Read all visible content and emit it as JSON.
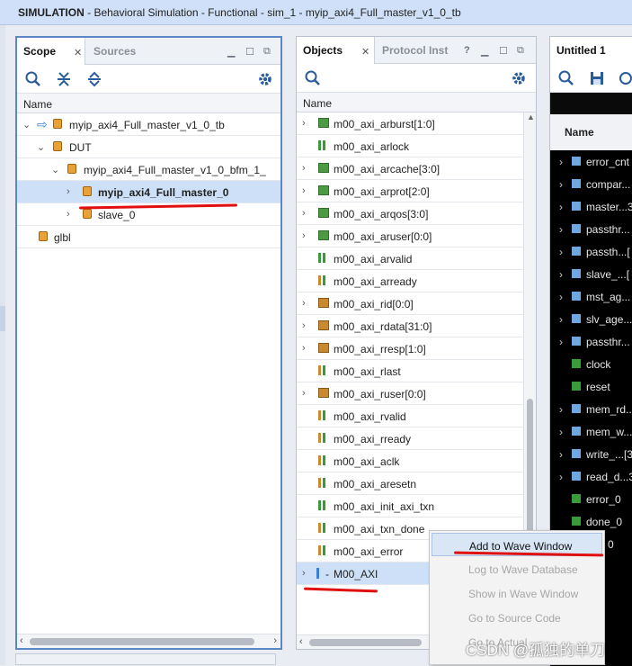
{
  "title": {
    "bold": "SIMULATION",
    "rest": " - Behavioral Simulation - Functional - sim_1 - myip_axi4_Full_master_v1_0_tb"
  },
  "scope": {
    "tabs": [
      "Scope",
      "Sources"
    ],
    "column": "Name",
    "rows": [
      "myip_axi4_Full_master_v1_0_tb",
      "DUT",
      "myip_axi4_Full_master_v1_0_bfm_1_",
      "myip_axi4_Full_master_0",
      "slave_0",
      "glbl"
    ]
  },
  "objects": {
    "tabs": [
      "Objects",
      "Protocol Inst"
    ],
    "help": "?",
    "column": "Name",
    "rows": [
      "m00_axi_arburst[1:0]",
      "m00_axi_arlock",
      "m00_axi_arcache[3:0]",
      "m00_axi_arprot[2:0]",
      "m00_axi_arqos[3:0]",
      "m00_axi_aruser[0:0]",
      "m00_axi_arvalid",
      "m00_axi_arready",
      "m00_axi_rid[0:0]",
      "m00_axi_rdata[31:0]",
      "m00_axi_rresp[1:0]",
      "m00_axi_rlast",
      "m00_axi_ruser[0:0]",
      "m00_axi_rvalid",
      "m00_axi_rready",
      "m00_axi_aclk",
      "m00_axi_aresetn",
      "m00_axi_init_axi_txn",
      "m00_axi_txn_done",
      "m00_axi_error",
      "M00_AXI"
    ]
  },
  "wave": {
    "tab": "Untitled 1",
    "column": "Name",
    "rows": [
      "error_cnt",
      "compar...",
      "master...3",
      "passthr...",
      "passth...[",
      "slave_...[",
      "mst_ag...",
      "slv_age...",
      "passthr...",
      "clock",
      "reset",
      "mem_rd...",
      "mem_w...",
      "write_...[3",
      "read_d...3",
      "error_0",
      "done_0",
      "0"
    ]
  },
  "context_menu": [
    "Add to Wave Window",
    "Log to Wave Database",
    "Show in Wave Window",
    "Go to Source Code",
    "Go to Actual"
  ],
  "watermark": "CSDN @孤独的单刀",
  "colors": {
    "accent": "#5b87c7",
    "selection": "#cde0f7",
    "annotation": "#e01010"
  }
}
